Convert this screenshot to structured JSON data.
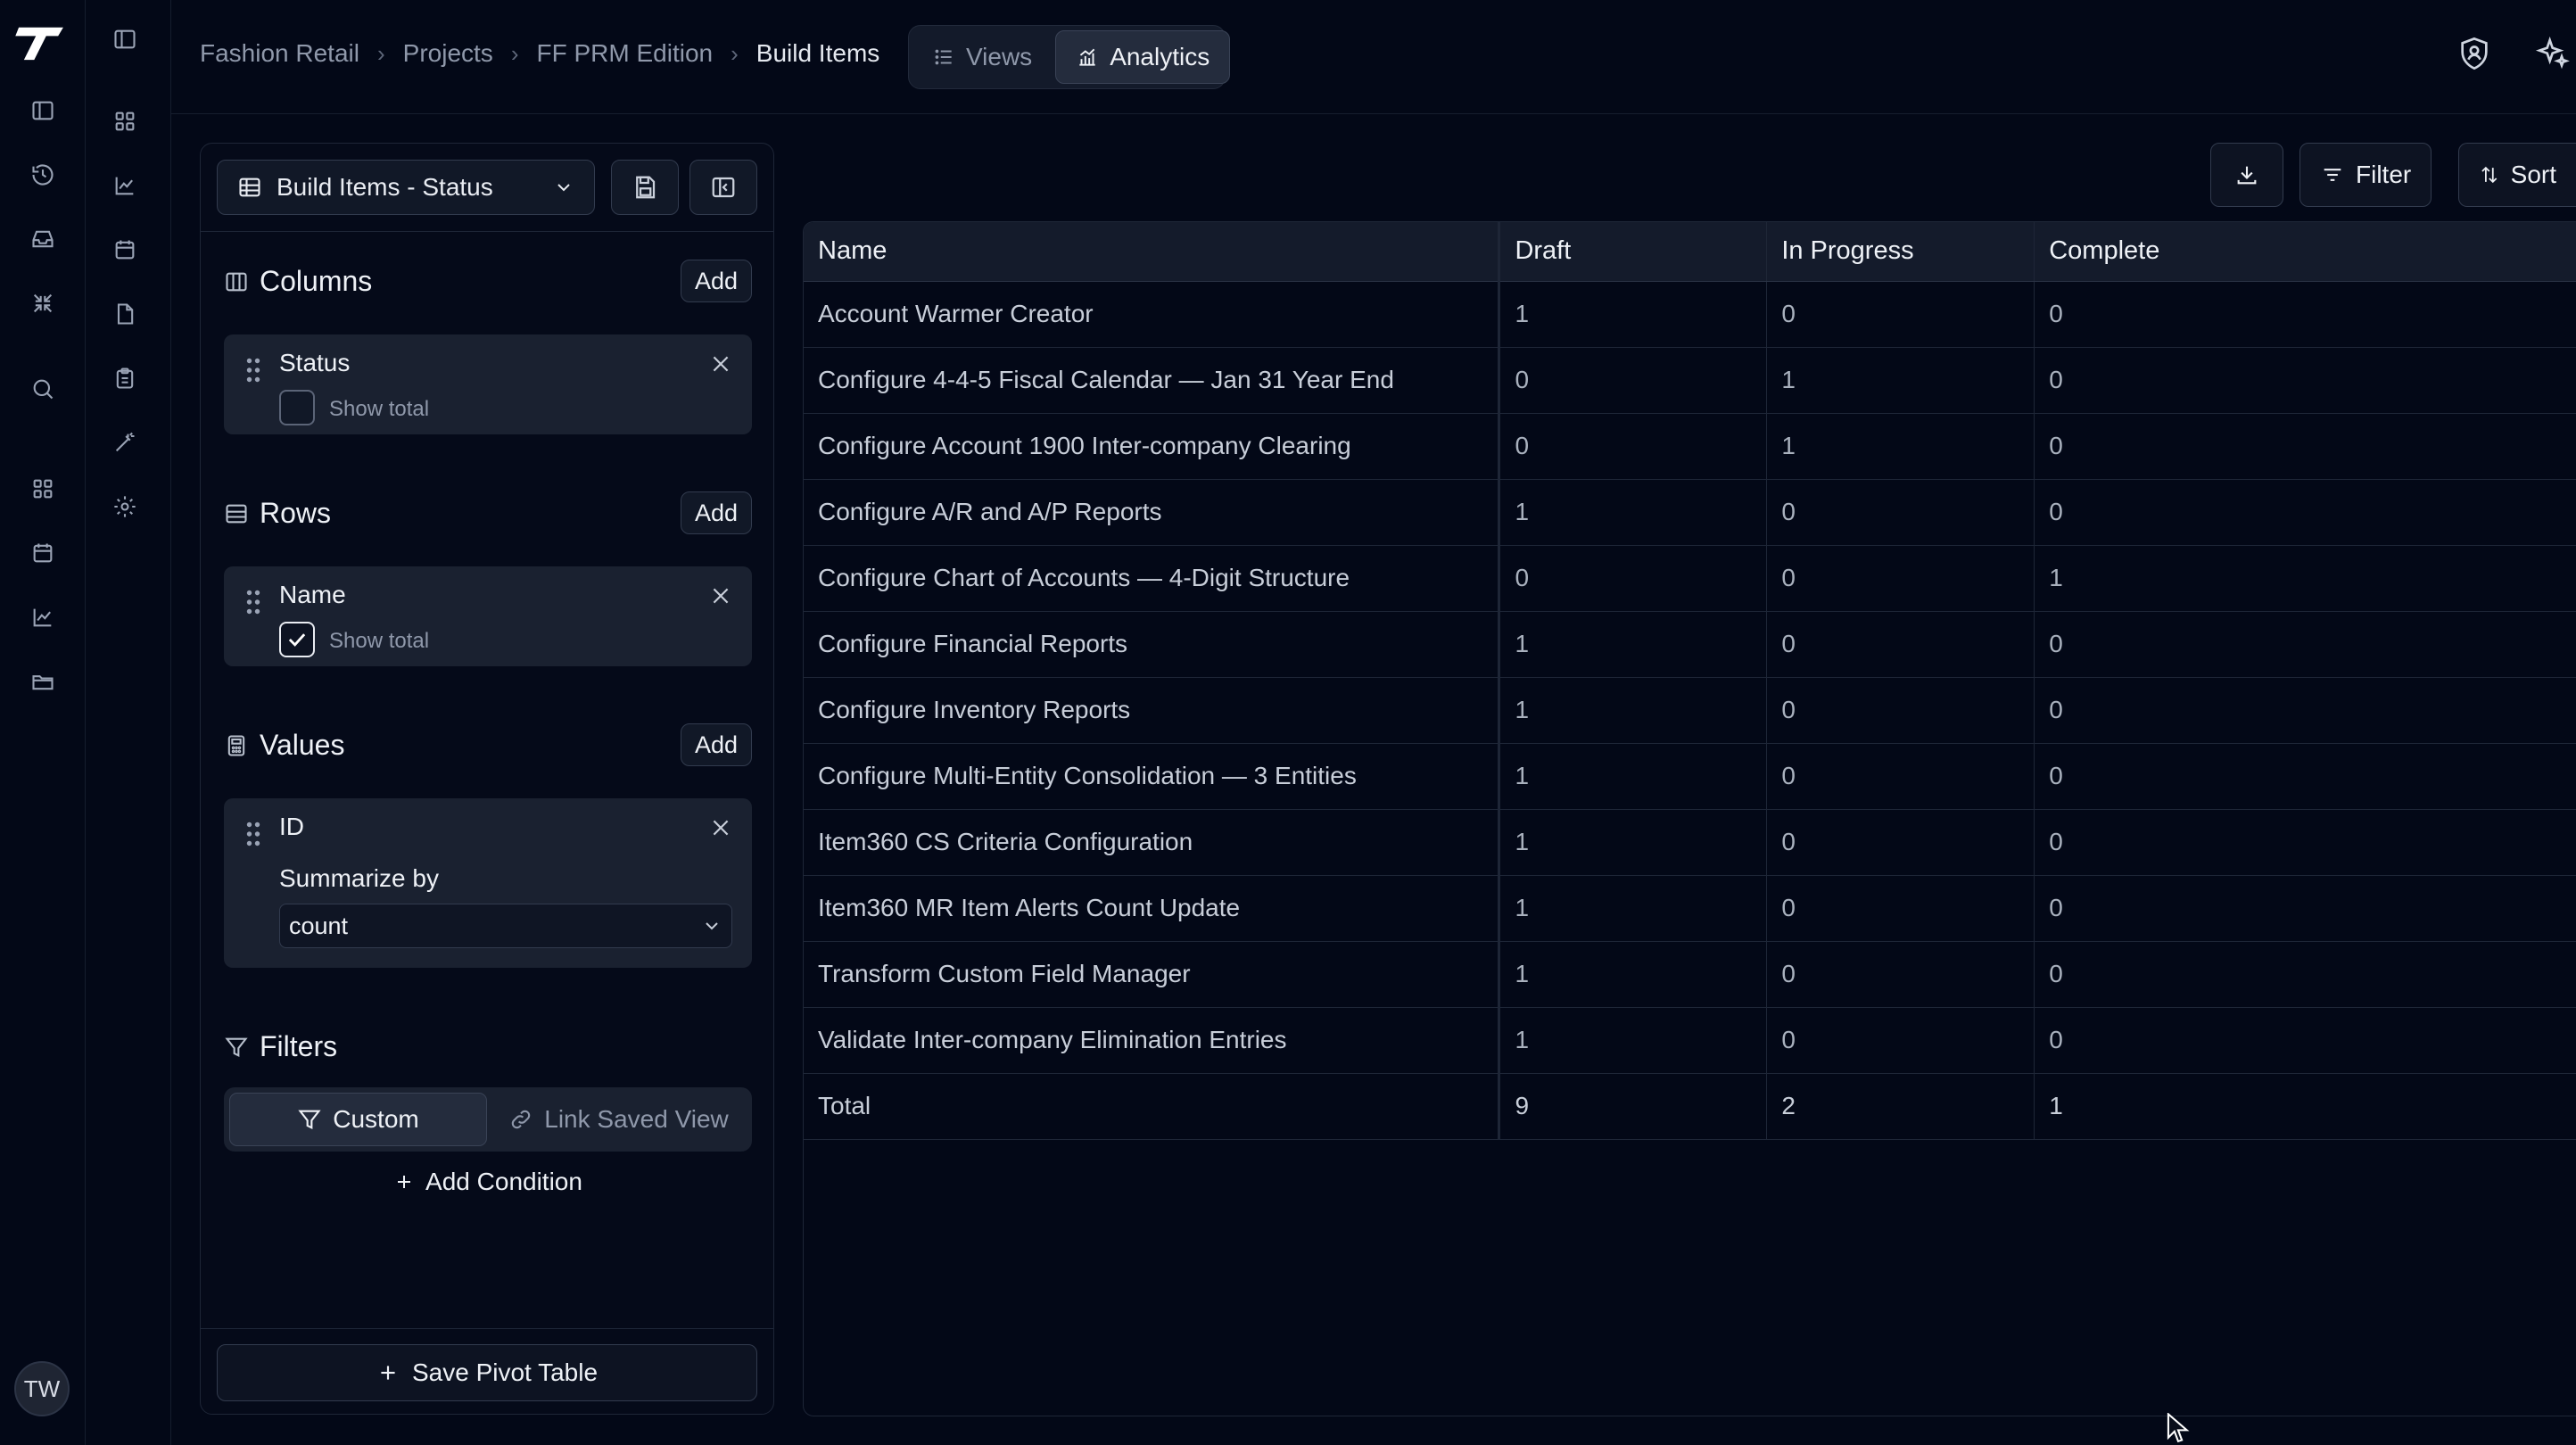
{
  "rail": {
    "avatar_initials": "TW"
  },
  "breadcrumb": [
    "Fashion Retail",
    "Projects",
    "FF PRM Edition",
    "Build Items"
  ],
  "view_tabs": {
    "views_label": "Views",
    "analytics_label": "Analytics",
    "active": "Analytics"
  },
  "panel": {
    "view_select": "Build Items - Status",
    "columns": {
      "title": "Columns",
      "add_label": "Add",
      "field": "Status",
      "show_total_label": "Show total",
      "show_total": false
    },
    "rows": {
      "title": "Rows",
      "add_label": "Add",
      "field": "Name",
      "show_total_label": "Show total",
      "show_total": true
    },
    "values": {
      "title": "Values",
      "add_label": "Add",
      "field": "ID",
      "summarize_label": "Summarize by",
      "summarize_value": "count"
    },
    "filters": {
      "title": "Filters",
      "custom_label": "Custom",
      "link_label": "Link Saved View",
      "add_condition": "Add Condition"
    },
    "save_label": "Save Pivot Table"
  },
  "toolbar": {
    "filter_label": "Filter",
    "sort_label": "Sort"
  },
  "table": {
    "headers": [
      "Name",
      "Draft",
      "In Progress",
      "Complete"
    ],
    "rows": [
      [
        "Account Warmer Creator",
        "1",
        "0",
        "0"
      ],
      [
        "Configure 4-4-5 Fiscal Calendar — Jan 31 Year End",
        "0",
        "1",
        "0"
      ],
      [
        "Configure Account 1900 Inter-company Clearing",
        "0",
        "1",
        "0"
      ],
      [
        "Configure A/R and A/P Reports",
        "1",
        "0",
        "0"
      ],
      [
        "Configure Chart of Accounts — 4-Digit Structure",
        "0",
        "0",
        "1"
      ],
      [
        "Configure Financial Reports",
        "1",
        "0",
        "0"
      ],
      [
        "Configure Inventory Reports",
        "1",
        "0",
        "0"
      ],
      [
        "Configure Multi-Entity Consolidation — 3 Entities",
        "1",
        "0",
        "0"
      ],
      [
        "Item360 CS Criteria Configuration",
        "1",
        "0",
        "0"
      ],
      [
        "Item360 MR Item Alerts Count Update",
        "1",
        "0",
        "0"
      ],
      [
        "Transform Custom Field Manager",
        "1",
        "0",
        "0"
      ],
      [
        "Validate Inter-company Elimination Entries",
        "1",
        "0",
        "0"
      ]
    ],
    "total": [
      "Total",
      "9",
      "2",
      "1"
    ]
  }
}
